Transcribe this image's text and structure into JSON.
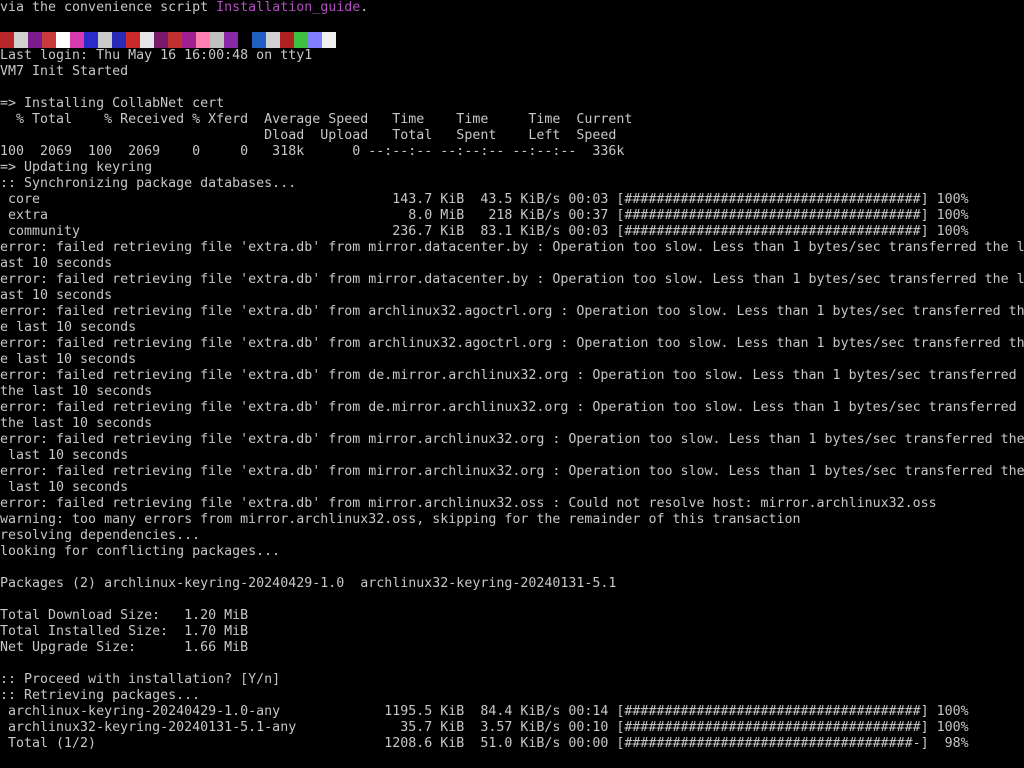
{
  "intro": {
    "text": "via the convenience script ",
    "link": "Installation_guide",
    "end": "."
  },
  "color_bar": [
    "#b8282a",
    "#d0d0d0",
    "#7c1c8c",
    "#c93a3a",
    "#ffffff",
    "#d63bb0",
    "#2b2bcc",
    "#c9c9c9",
    "#2a2ab8",
    "#cc2a2a",
    "#e6e6e6",
    "#7a1a6a",
    "#c03030",
    "#a02090",
    "#ff80b0",
    "#c0c0c0",
    "#8a2aaa",
    "#000000",
    "#2060c0",
    "#d0d0d0",
    "#b02020",
    "#40c040",
    "#8080ff",
    "#f0f0f0"
  ],
  "lines": [
    "Last login: Thu May 16 16:00:48 on tty1",
    "VM7 Init Started",
    "",
    "=> Installing CollabNet cert",
    "  % Total    % Received % Xferd  Average Speed   Time    Time     Time  Current",
    "                                 Dload  Upload   Total   Spent    Left  Speed",
    "100  2069  100  2069    0     0   318k      0 --:--:-- --:--:-- --:--:--  336k",
    "=> Updating keyring",
    ":: Synchronizing package databases...",
    " core                                            143.7 KiB  43.5 KiB/s 00:03 [#####################################] 100%",
    " extra                                             8.0 MiB   218 KiB/s 00:37 [#####################################] 100%",
    " community                                       236.7 KiB  83.1 KiB/s 00:03 [#####################################] 100%",
    "error: failed retrieving file 'extra.db' from mirror.datacenter.by : Operation too slow. Less than 1 bytes/sec transferred the l",
    "ast 10 seconds",
    "error: failed retrieving file 'extra.db' from mirror.datacenter.by : Operation too slow. Less than 1 bytes/sec transferred the l",
    "ast 10 seconds",
    "error: failed retrieving file 'extra.db' from archlinux32.agoctrl.org : Operation too slow. Less than 1 bytes/sec transferred th",
    "e last 10 seconds",
    "error: failed retrieving file 'extra.db' from archlinux32.agoctrl.org : Operation too slow. Less than 1 bytes/sec transferred th",
    "e last 10 seconds",
    "error: failed retrieving file 'extra.db' from de.mirror.archlinux32.org : Operation too slow. Less than 1 bytes/sec transferred",
    "the last 10 seconds",
    "error: failed retrieving file 'extra.db' from de.mirror.archlinux32.org : Operation too slow. Less than 1 bytes/sec transferred",
    "the last 10 seconds",
    "error: failed retrieving file 'extra.db' from mirror.archlinux32.org : Operation too slow. Less than 1 bytes/sec transferred the",
    " last 10 seconds",
    "error: failed retrieving file 'extra.db' from mirror.archlinux32.org : Operation too slow. Less than 1 bytes/sec transferred the",
    " last 10 seconds",
    "error: failed retrieving file 'extra.db' from mirror.archlinux32.oss : Could not resolve host: mirror.archlinux32.oss",
    "warning: too many errors from mirror.archlinux32.oss, skipping for the remainder of this transaction",
    "resolving dependencies...",
    "looking for conflicting packages...",
    "",
    "Packages (2) archlinux-keyring-20240429-1.0  archlinux32-keyring-20240131-5.1",
    "",
    "Total Download Size:   1.20 MiB",
    "Total Installed Size:  1.70 MiB",
    "Net Upgrade Size:      1.66 MiB",
    "",
    ":: Proceed with installation? [Y/n]",
    ":: Retrieving packages...",
    " archlinux-keyring-20240429-1.0-any             1195.5 KiB  84.4 KiB/s 00:14 [#####################################] 100%",
    " archlinux32-keyring-20240131-5.1-any             35.7 KiB  3.57 KiB/s 00:10 [#####################################] 100%",
    " Total (1/2)                                    1208.6 KiB  51.0 KiB/s 00:00 [####################################-]  98%"
  ]
}
